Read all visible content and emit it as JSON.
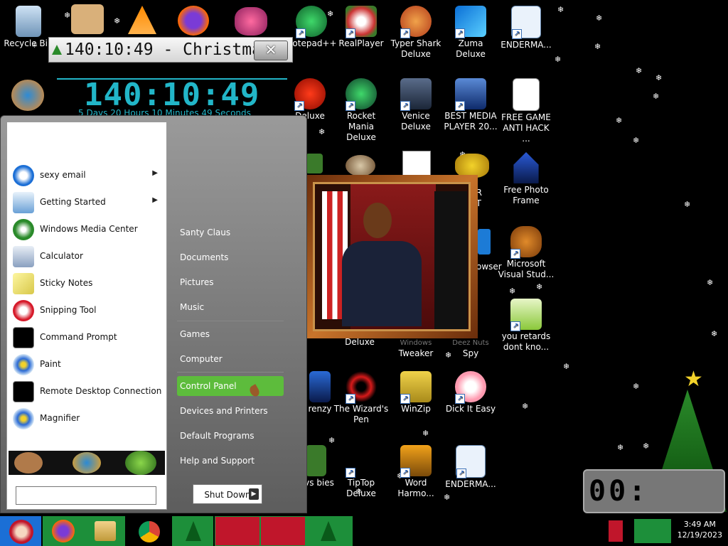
{
  "countdown": {
    "window_title": "140:10:49 - Christma...",
    "big_time": "140:10:49",
    "subtitle": "5 Days 20 Hours 10 Minutes 49 Seconds",
    "close_glyph": "✕"
  },
  "desktop_icons": [
    {
      "label": "Recycle Bin",
      "icon": "recycle-bin-icon"
    },
    {
      "label": "Notepad++",
      "icon": "notepad-plus-icon"
    },
    {
      "label": "RealPlayer",
      "icon": "realplayer-icon"
    },
    {
      "label": "Typer Shark Deluxe",
      "icon": "typer-shark-icon"
    },
    {
      "label": "Zuma Deluxe",
      "icon": "zuma-icon"
    },
    {
      "label": "ENDERMA...",
      "icon": "enderman-icon"
    },
    {
      "label": "Deluxe",
      "icon": "deluxe-game-icon"
    },
    {
      "label": "Rocket Mania Deluxe",
      "icon": "rocket-mania-icon"
    },
    {
      "label": "Venice Deluxe",
      "icon": "venice-icon"
    },
    {
      "label": "BEST MEDIA PLAYER 20...",
      "icon": "media-player-icon"
    },
    {
      "label": "FREE GAME ANTI HACK ...",
      "icon": "anti-hack-icon"
    },
    {
      "label": "Free Photo Frame",
      "icon": "photo-frame-icon"
    },
    {
      "label": "Microsoft Visual Stud...",
      "icon": "visual-studio-icon"
    },
    {
      "label": "you retards dont kno...",
      "icon": "notes-icon"
    },
    {
      "label": "Deluxe",
      "icon": "deluxe-icon"
    },
    {
      "label": "Tweaker",
      "icon": "tweaker-icon"
    },
    {
      "label": "Spy",
      "icon": "spy-icon"
    },
    {
      "label": "renzy",
      "icon": "frenzy-icon"
    },
    {
      "label": "The Wizard's Pen",
      "icon": "wizards-pen-icon"
    },
    {
      "label": "WinZip",
      "icon": "winzip-icon"
    },
    {
      "label": "Dick It Easy",
      "icon": "flower-icon"
    },
    {
      "label": "s vs bies",
      "icon": "zombies-icon"
    },
    {
      "label": "TipTop Deluxe",
      "icon": "tiptop-icon"
    },
    {
      "label": "Word Harmo...",
      "icon": "word-harmony-icon"
    },
    {
      "label": "ENDERMA...",
      "icon": "enderman2-icon"
    },
    {
      "label": "ER",
      "icon": "er-icon"
    },
    {
      "label": "ST",
      "icon": "st-icon"
    },
    {
      "label": "owser",
      "icon": "browser-icon"
    }
  ],
  "start_menu": {
    "programs": [
      {
        "label": "sexy email",
        "icon": "thunderbird-icon",
        "arrow": "▶"
      },
      {
        "label": "Getting Started",
        "icon": "getting-started-icon",
        "arrow": "▶"
      },
      {
        "label": "Windows Media Center",
        "icon": "windows-media-center-icon",
        "arrow": ""
      },
      {
        "label": "Calculator",
        "icon": "calculator-icon",
        "arrow": ""
      },
      {
        "label": "Sticky Notes",
        "icon": "sticky-notes-icon",
        "arrow": ""
      },
      {
        "label": "Snipping Tool",
        "icon": "snipping-tool-icon",
        "arrow": ""
      },
      {
        "label": "Command Prompt",
        "icon": "command-prompt-icon",
        "arrow": ""
      },
      {
        "label": "Paint",
        "icon": "paint-icon",
        "arrow": ""
      },
      {
        "label": "Remote Desktop Connection",
        "icon": "remote-desktop-icon",
        "arrow": ""
      },
      {
        "label": "Magnifier",
        "icon": "magnifier-icon",
        "arrow": ""
      }
    ],
    "right_items": [
      {
        "label": "Santy Claus"
      },
      {
        "label": "Documents"
      },
      {
        "label": "Pictures"
      },
      {
        "label": "Music"
      },
      {
        "label": "Games"
      },
      {
        "label": "Computer"
      },
      {
        "label": "Control Panel"
      },
      {
        "label": "Devices and Printers"
      },
      {
        "label": "Default Programs"
      },
      {
        "label": "Help and Support"
      }
    ],
    "shutdown_label": "Shut Down",
    "shutdown_arrow": "▶",
    "search_placeholder": ""
  },
  "miniclock": {
    "display": "00:"
  },
  "taskbar": {
    "buttons": [
      {
        "icon": "santa-start-icon",
        "color": "#c0162b"
      },
      {
        "icon": "firefox-icon",
        "color": "#1d8f3a"
      },
      {
        "icon": "explorer-icon",
        "color": "#1d8f3a"
      },
      {
        "icon": "chrome-icon",
        "color": "#000000"
      },
      {
        "icon": "christmas-tree-icon",
        "color": "#1d8f3a"
      },
      {
        "icon": "gift-wrap-icon",
        "color": "#c0162b"
      },
      {
        "icon": "gift-wrap-icon",
        "color": "#c0162b"
      },
      {
        "icon": "christmas-tree-icon",
        "color": "#1d8f3a"
      }
    ],
    "time": "3:49 AM",
    "date": "12/19/2023"
  },
  "colors": {
    "accent_green": "#5dbc3c",
    "countdown_cyan": "#22b6c8",
    "task_green": "#1d8f3a",
    "task_red": "#c0162b"
  }
}
